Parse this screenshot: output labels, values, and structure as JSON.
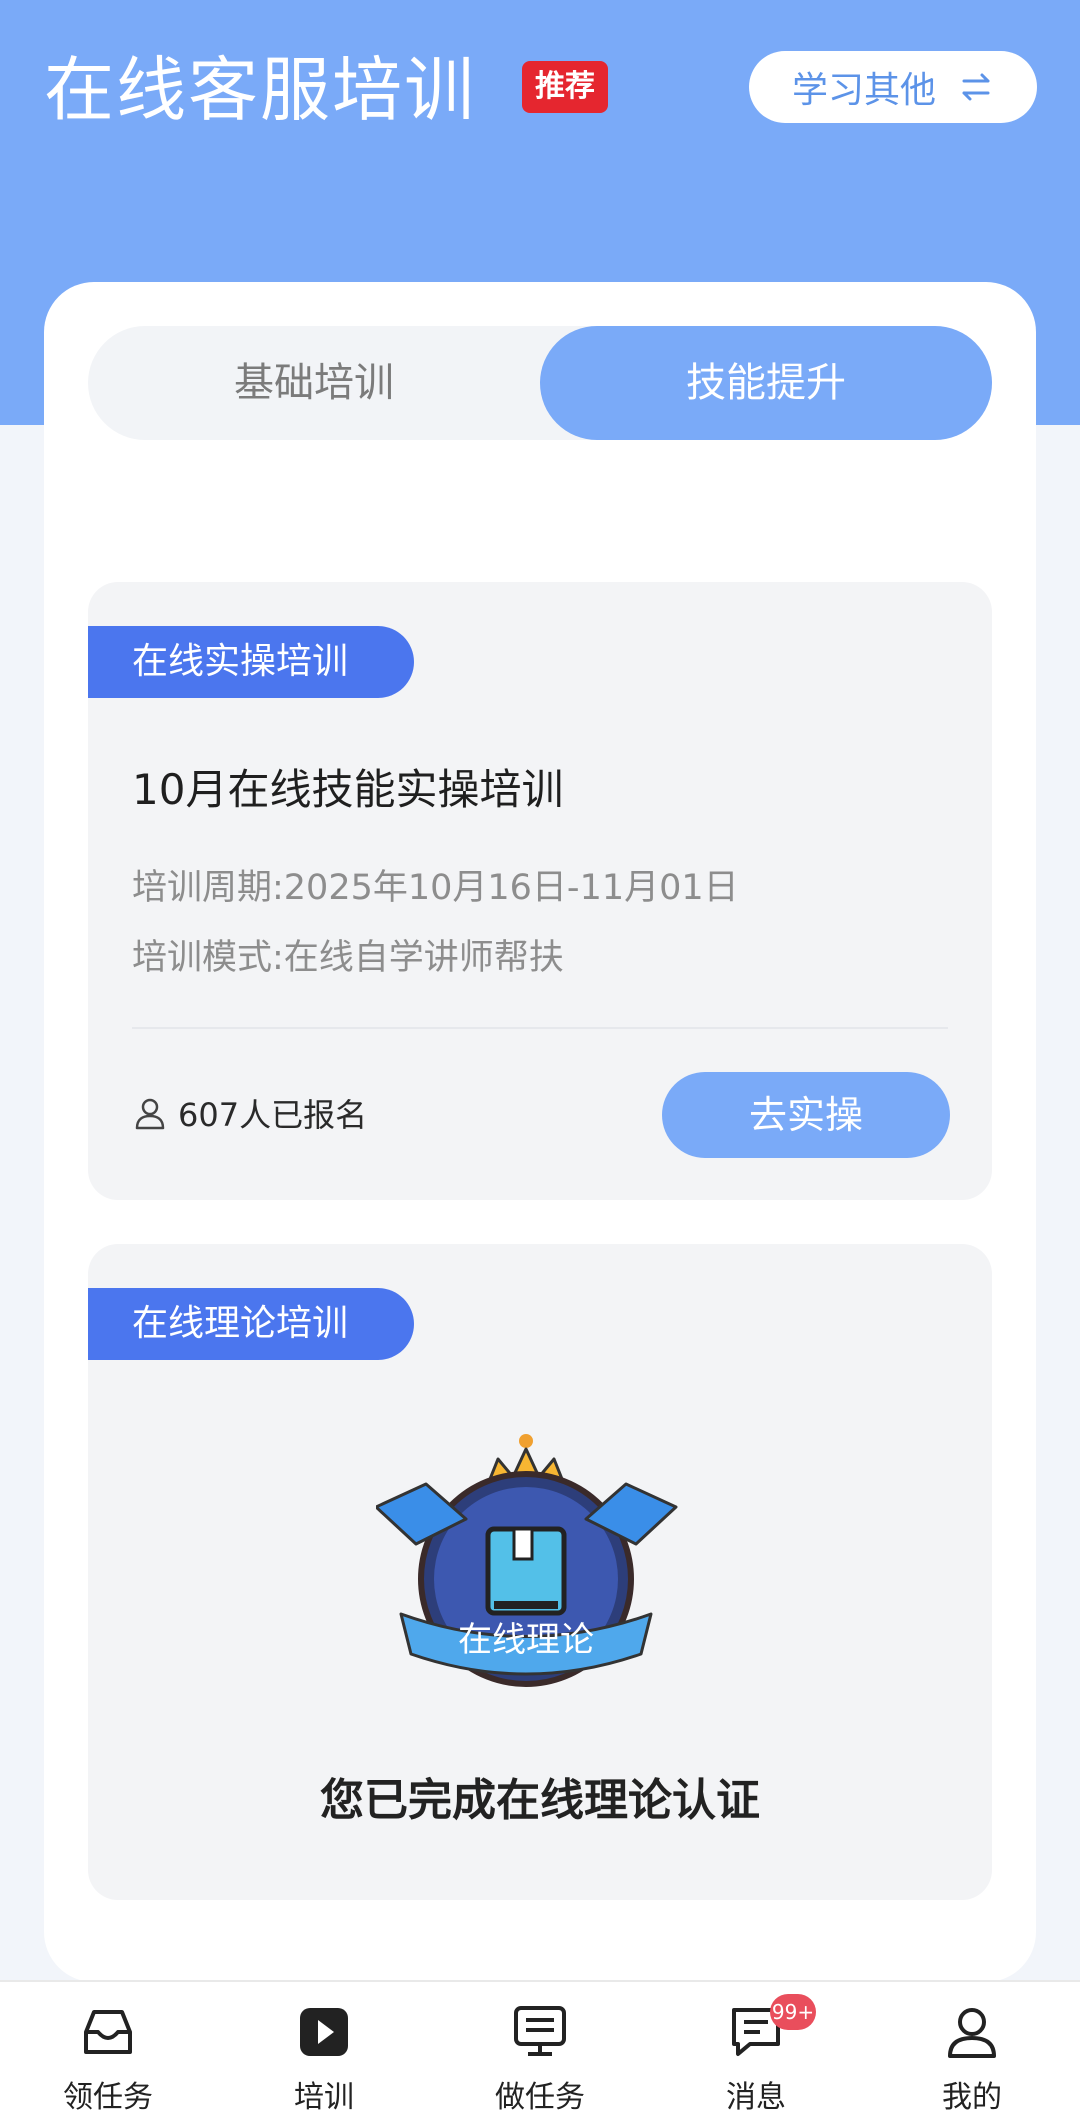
{
  "header": {
    "title": "在线客服培训",
    "badge": "推荐",
    "switch_label": "学习其他"
  },
  "tabs": [
    {
      "label": "基础培训",
      "active": false
    },
    {
      "label": "技能提升",
      "active": true
    }
  ],
  "practical_card": {
    "tag": "在线实操培训",
    "title": "10月在线技能实操培训",
    "period": "培训周期:2025年10月16日-11月01日",
    "mode": "培训模式:在线自学讲师帮扶",
    "enrolled": "607人已报名",
    "button": "去实操"
  },
  "theory_card": {
    "tag": "在线理论培训",
    "badge_text": "在线理论",
    "completed_text": "您已完成在线理论认证"
  },
  "bottom_nav": [
    {
      "label": "领任务",
      "icon": "inbox-icon"
    },
    {
      "label": "培训",
      "icon": "play-icon"
    },
    {
      "label": "做任务",
      "icon": "monitor-icon"
    },
    {
      "label": "消息",
      "icon": "chat-icon",
      "count": "99+"
    },
    {
      "label": "我的",
      "icon": "user-icon"
    }
  ],
  "colors": {
    "header_blue": "#7aaaf8",
    "tag_blue": "#4b76ee",
    "badge_red": "#e5262f"
  }
}
